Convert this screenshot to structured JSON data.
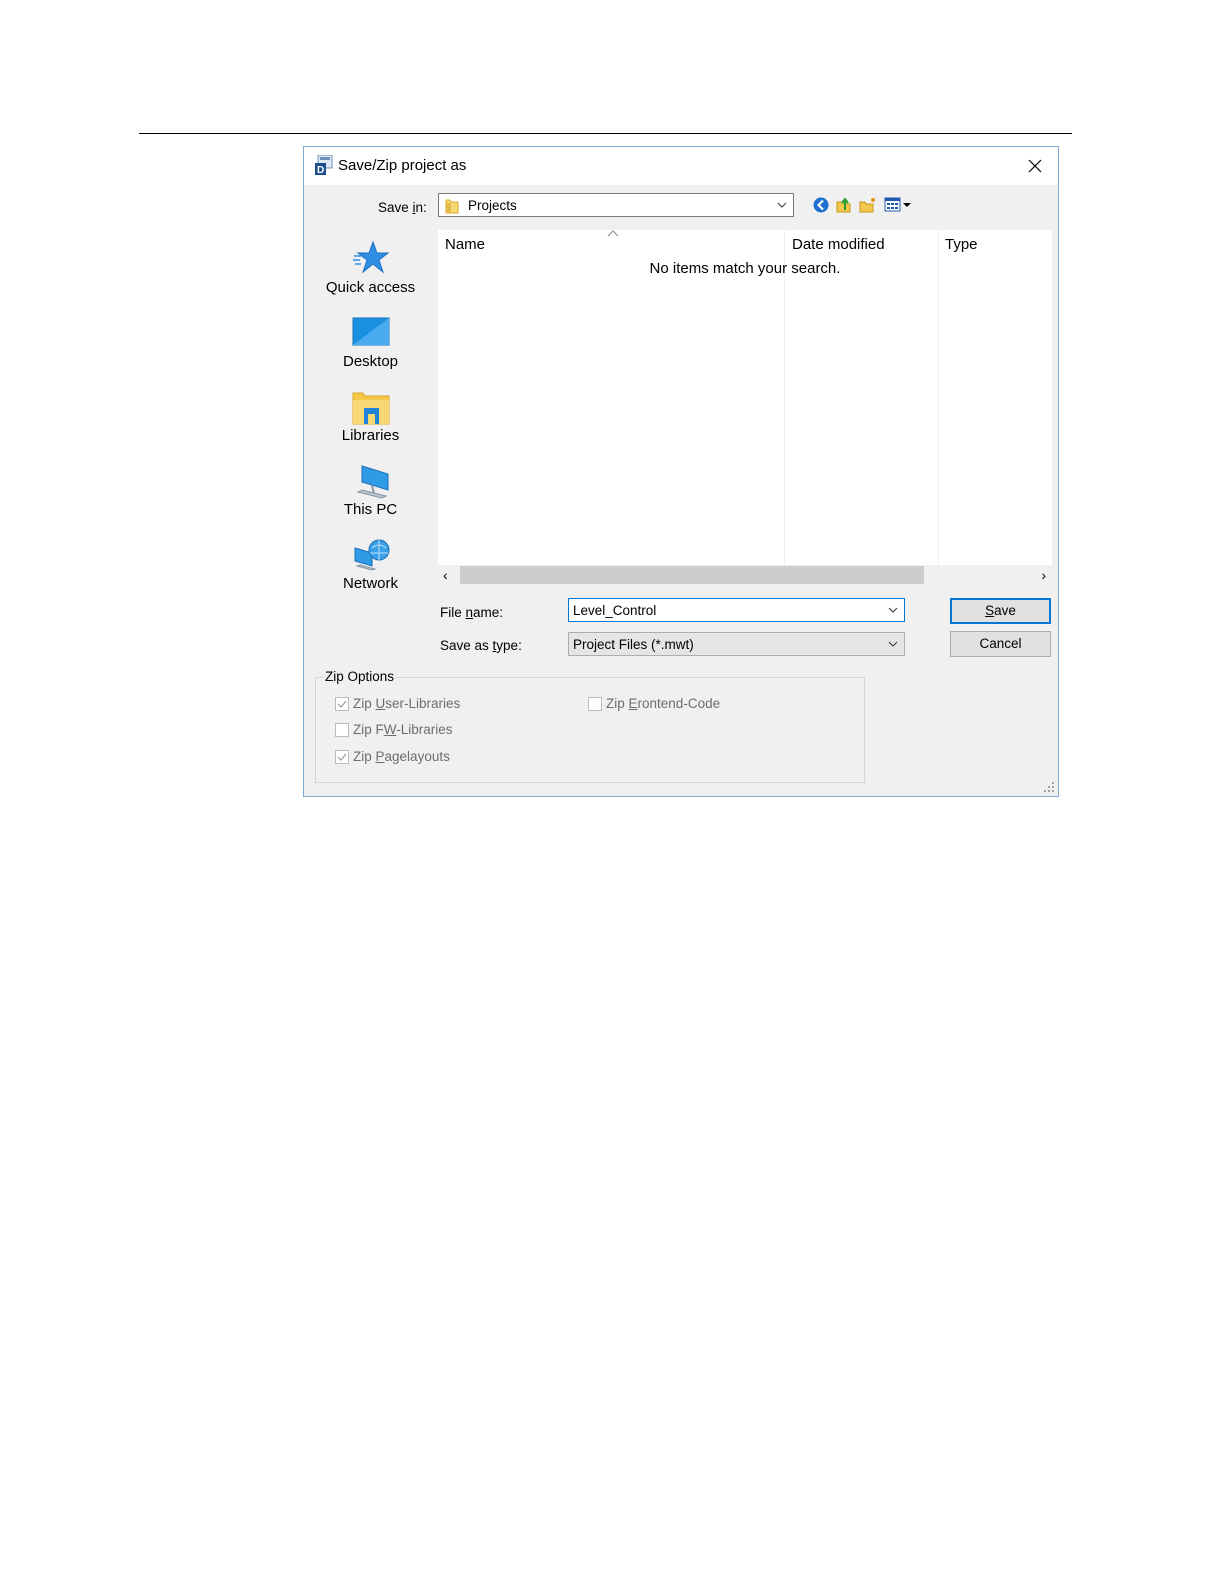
{
  "dialog": {
    "title": "Save/Zip project as",
    "save_in": {
      "label_pre": "Save ",
      "label_u": "i",
      "label_post": "n:",
      "value": "Projects"
    },
    "places": [
      {
        "label": "Quick access"
      },
      {
        "label": "Desktop"
      },
      {
        "label": "Libraries"
      },
      {
        "label": "This PC"
      },
      {
        "label": "Network"
      }
    ],
    "file_list": {
      "columns": [
        "Name",
        "Date modified",
        "Type"
      ],
      "empty_message": "No items match your search."
    },
    "file_name": {
      "label_pre": "File ",
      "label_u": "n",
      "label_post": "ame:",
      "value": "Level_Control"
    },
    "save_as_type": {
      "label_pre": "Save as ",
      "label_u": "t",
      "label_post": "ype:",
      "value": "Project Files (*.mwt)"
    },
    "buttons": {
      "save": {
        "pre": "",
        "u": "S",
        "post": "ave"
      },
      "cancel": "Cancel"
    },
    "zip_options": {
      "title": "Zip Options",
      "items": [
        {
          "pre": "Zip ",
          "u": "U",
          "post": "ser-Libraries",
          "checked": true
        },
        {
          "pre": "Zip ",
          "u": "E",
          "post": "rontend-Code",
          "checked": false
        },
        {
          "pre": "Zip F",
          "u": "W",
          "post": "-Libraries",
          "checked": false
        },
        {
          "pre": "Zip ",
          "u": "P",
          "post": "agelayouts",
          "checked": true
        }
      ]
    }
  }
}
